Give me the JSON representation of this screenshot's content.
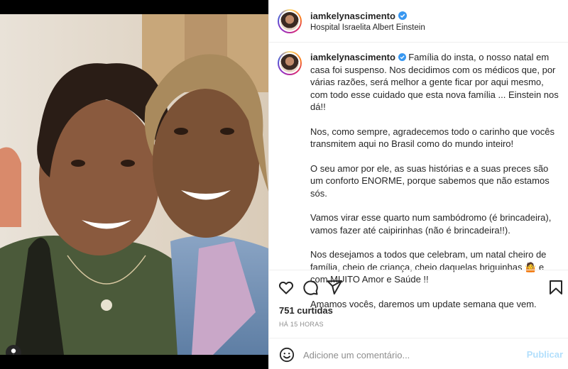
{
  "post": {
    "username": "iamkelynascimento",
    "verified": true,
    "location": "Hospital Israelita Albert Einstein",
    "caption": [
      "Família do insta, o nosso natal em casa foi suspenso. Nos decidimos com os médicos que, por várias razões, será melhor a gente ficar por aqui mesmo, com todo esse cuidado que esta nova família ... Einstein nos dá!!",
      "Nos, como sempre, agradecemos todo o carinho que vocês transmitem aqui no Brasil como do mundo inteiro!",
      "O seu amor por ele, as suas histórias e a suas preces são um conforto ENORME, porque sabemos que não estamos sós.",
      "Vamos virar esse quarto num sambódromo (é brincadeira), vamos fazer até caipirinhas (não é brincadeira!!).",
      "Nos desejamos a todos que celebram, um natal cheiro de família, cheio de criança, cheio daquelas briguinhas 🤷 e com MUITO Amor e Saúde !!",
      "Amamos vocês, daremos um update semana que vem."
    ],
    "likes": "751 curtidas",
    "timestamp": "HÁ 15 HORAS"
  },
  "comment": {
    "placeholder": "Adicione um comentário...",
    "publish_label": "Publicar"
  },
  "icons": {
    "like": "heart-icon",
    "comment": "comment-icon",
    "share": "share-icon",
    "save": "bookmark-icon",
    "emoji": "emoji-icon",
    "tag": "user-tag-icon"
  },
  "colors": {
    "verified": "#3897f0",
    "publish_disabled": "#b2dffc",
    "secondary_text": "#8e8e8e"
  }
}
